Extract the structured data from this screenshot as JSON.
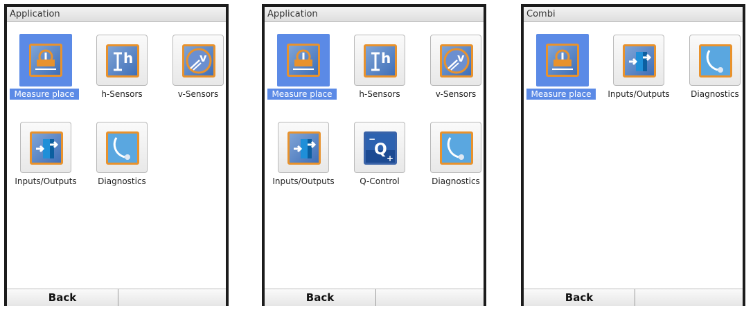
{
  "screens": [
    {
      "title": "Application",
      "items": [
        {
          "label": "Measure place",
          "icon": "measure-place-icon",
          "selected": true
        },
        {
          "label": "h-Sensors",
          "icon": "h-sensor-icon",
          "selected": false
        },
        {
          "label": "v-Sensors",
          "icon": "v-sensor-icon",
          "selected": false
        },
        {
          "label": "Inputs/Outputs",
          "icon": "door-arrow-icon",
          "selected": false
        },
        {
          "label": "Diagnostics",
          "icon": "stethoscope-icon",
          "selected": false
        }
      ],
      "back_label": "Back"
    },
    {
      "title": "Application",
      "items": [
        {
          "label": "Measure place",
          "icon": "measure-place-icon",
          "selected": true
        },
        {
          "label": "h-Sensors",
          "icon": "h-sensor-icon",
          "selected": false
        },
        {
          "label": "v-Sensors",
          "icon": "v-sensor-icon",
          "selected": false
        },
        {
          "label": "Inputs/Outputs",
          "icon": "door-arrow-icon",
          "selected": false
        },
        {
          "label": "Q-Control",
          "icon": "q-control-icon",
          "selected": false
        },
        {
          "label": "Diagnostics",
          "icon": "stethoscope-icon",
          "selected": false
        }
      ],
      "back_label": "Back"
    },
    {
      "title": "Combi",
      "items": [
        {
          "label": "Measure place",
          "icon": "measure-place-icon",
          "selected": true
        },
        {
          "label": "Inputs/Outputs",
          "icon": "door-arrow-icon",
          "selected": false
        },
        {
          "label": "Diagnostics",
          "icon": "stethoscope-icon",
          "selected": false
        }
      ],
      "back_label": "Back"
    }
  ],
  "colors": {
    "selection": "#5b8ae6",
    "icon_border": "#e8922d",
    "icon_blue": "#3f6fb8"
  }
}
